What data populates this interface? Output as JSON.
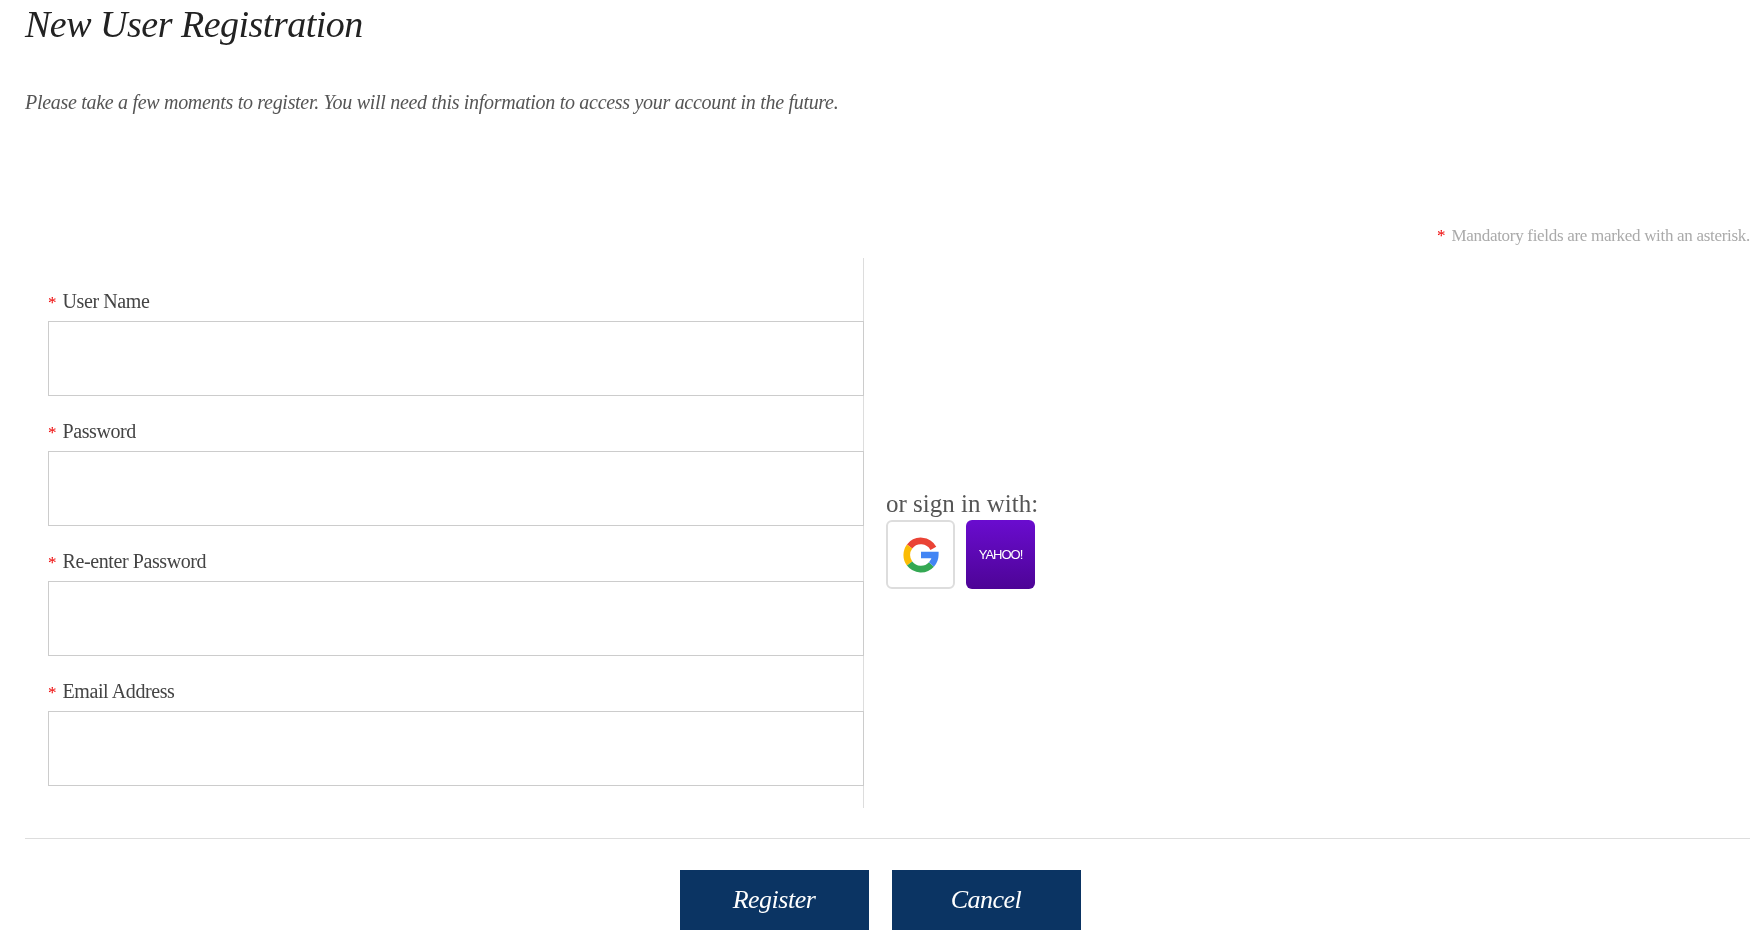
{
  "title": "New User Registration",
  "intro": "Please take a few moments to register. You will need this information to access your account in the future.",
  "mandatory_note": {
    "marker": "*",
    "text": "Mandatory fields are marked with an asterisk."
  },
  "fields": [
    {
      "label": "User Name",
      "required_marker": "*"
    },
    {
      "label": "Password",
      "required_marker": "*"
    },
    {
      "label": "Re-enter Password",
      "required_marker": "*"
    },
    {
      "label": "Email Address",
      "required_marker": "*"
    }
  ],
  "social": {
    "label": "or sign in with:",
    "providers": [
      {
        "kind": "google"
      },
      {
        "kind": "yahoo",
        "text": "YAHOO!"
      }
    ]
  },
  "buttons": [
    "Register",
    "Cancel"
  ]
}
